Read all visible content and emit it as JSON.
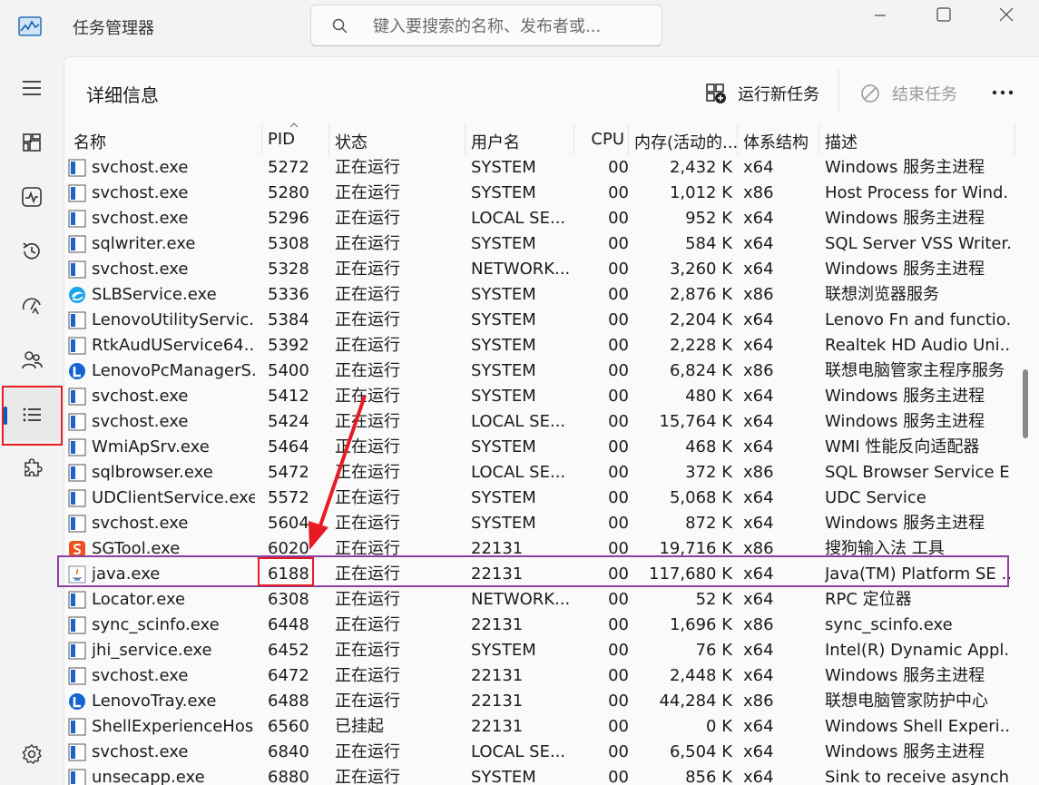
{
  "app": {
    "title": "任务管理器",
    "search_placeholder": "键入要搜索的名称、发布者或..."
  },
  "page": {
    "title": "详细信息",
    "run_new_task": "运行新任务",
    "end_task": "结束任务"
  },
  "columns": [
    "名称",
    "PID",
    "状态",
    "用户名",
    "CPU",
    "内存(活动的...",
    "体系结构",
    "描述"
  ],
  "accent_color": "#005fb8",
  "highlight_row_color": "#8b3fa0",
  "annotation_color": "#e81a24",
  "rows": [
    {
      "icon": "svc-icon",
      "name": "svchost.exe",
      "pid": "5272",
      "status": "正在运行",
      "user": "SYSTEM",
      "cpu": "00",
      "mem": "2,432 K",
      "arch": "x64",
      "desc": "Windows 服务主进程"
    },
    {
      "icon": "svc-icon",
      "name": "svchost.exe",
      "pid": "5280",
      "status": "正在运行",
      "user": "SYSTEM",
      "cpu": "00",
      "mem": "1,012 K",
      "arch": "x86",
      "desc": "Host Process for Wind..."
    },
    {
      "icon": "svc-icon",
      "name": "svchost.exe",
      "pid": "5296",
      "status": "正在运行",
      "user": "LOCAL SE...",
      "cpu": "00",
      "mem": "952 K",
      "arch": "x64",
      "desc": "Windows 服务主进程"
    },
    {
      "icon": "svc-icon",
      "name": "sqlwriter.exe",
      "pid": "5308",
      "status": "正在运行",
      "user": "SYSTEM",
      "cpu": "00",
      "mem": "584 K",
      "arch": "x64",
      "desc": "SQL Server VSS Writer..."
    },
    {
      "icon": "svc-icon",
      "name": "svchost.exe",
      "pid": "5328",
      "status": "正在运行",
      "user": "NETWORK...",
      "cpu": "00",
      "mem": "3,260 K",
      "arch": "x64",
      "desc": "Windows 服务主进程"
    },
    {
      "icon": "browser-icon",
      "name": "SLBService.exe",
      "pid": "5336",
      "status": "正在运行",
      "user": "SYSTEM",
      "cpu": "00",
      "mem": "2,876 K",
      "arch": "x86",
      "desc": "联想浏览器服务"
    },
    {
      "icon": "svc-icon",
      "name": "LenovoUtilityServic...",
      "pid": "5384",
      "status": "正在运行",
      "user": "SYSTEM",
      "cpu": "00",
      "mem": "2,204 K",
      "arch": "x64",
      "desc": "Lenovo Fn and functio..."
    },
    {
      "icon": "svc-icon",
      "name": "RtkAudUService64....",
      "pid": "5392",
      "status": "正在运行",
      "user": "SYSTEM",
      "cpu": "00",
      "mem": "2,228 K",
      "arch": "x64",
      "desc": "Realtek HD Audio Uni..."
    },
    {
      "icon": "lenovo-icon",
      "name": "LenovoPcManagerS...",
      "pid": "5400",
      "status": "正在运行",
      "user": "SYSTEM",
      "cpu": "00",
      "mem": "6,824 K",
      "arch": "x86",
      "desc": "联想电脑管家主程序服务"
    },
    {
      "icon": "svc-icon",
      "name": "svchost.exe",
      "pid": "5412",
      "status": "正在运行",
      "user": "SYSTEM",
      "cpu": "00",
      "mem": "480 K",
      "arch": "x64",
      "desc": "Windows 服务主进程"
    },
    {
      "icon": "svc-icon",
      "name": "svchost.exe",
      "pid": "5424",
      "status": "正在运行",
      "user": "LOCAL SE...",
      "cpu": "00",
      "mem": "15,764 K",
      "arch": "x64",
      "desc": "Windows 服务主进程"
    },
    {
      "icon": "svc-icon",
      "name": "WmiApSrv.exe",
      "pid": "5464",
      "status": "正在运行",
      "user": "SYSTEM",
      "cpu": "00",
      "mem": "468 K",
      "arch": "x64",
      "desc": "WMI 性能反向适配器"
    },
    {
      "icon": "svc-icon",
      "name": "sqlbrowser.exe",
      "pid": "5472",
      "status": "正在运行",
      "user": "LOCAL SE...",
      "cpu": "00",
      "mem": "372 K",
      "arch": "x86",
      "desc": "SQL Browser Service E..."
    },
    {
      "icon": "svc-icon",
      "name": "UDClientService.exe",
      "pid": "5572",
      "status": "正在运行",
      "user": "SYSTEM",
      "cpu": "00",
      "mem": "5,068 K",
      "arch": "x64",
      "desc": "UDC Service"
    },
    {
      "icon": "svc-icon",
      "name": "svchost.exe",
      "pid": "5604",
      "status": "正在运行",
      "user": "SYSTEM",
      "cpu": "00",
      "mem": "872 K",
      "arch": "x64",
      "desc": "Windows 服务主进程"
    },
    {
      "icon": "sogou-icon",
      "name": "SGTool.exe",
      "pid": "6020",
      "status": "正在运行",
      "user": "22131",
      "cpu": "00",
      "mem": "19,716 K",
      "arch": "x86",
      "desc": "搜狗输入法 工具"
    },
    {
      "icon": "java-icon",
      "name": "java.exe",
      "pid": "6188",
      "status": "正在运行",
      "user": "22131",
      "cpu": "00",
      "mem": "117,680 K",
      "arch": "x64",
      "desc": "Java(TM) Platform SE ..."
    },
    {
      "icon": "svc-icon",
      "name": "Locator.exe",
      "pid": "6308",
      "status": "正在运行",
      "user": "NETWORK...",
      "cpu": "00",
      "mem": "52 K",
      "arch": "x64",
      "desc": "RPC 定位器"
    },
    {
      "icon": "svc-icon",
      "name": "sync_scinfo.exe",
      "pid": "6448",
      "status": "正在运行",
      "user": "22131",
      "cpu": "00",
      "mem": "1,696 K",
      "arch": "x86",
      "desc": "sync_scinfo.exe"
    },
    {
      "icon": "svc-icon",
      "name": "jhi_service.exe",
      "pid": "6452",
      "status": "正在运行",
      "user": "SYSTEM",
      "cpu": "00",
      "mem": "76 K",
      "arch": "x64",
      "desc": "Intel(R) Dynamic Appl..."
    },
    {
      "icon": "svc-icon",
      "name": "svchost.exe",
      "pid": "6472",
      "status": "正在运行",
      "user": "22131",
      "cpu": "00",
      "mem": "2,448 K",
      "arch": "x64",
      "desc": "Windows 服务主进程"
    },
    {
      "icon": "lenovo-icon",
      "name": "LenovoTray.exe",
      "pid": "6488",
      "status": "正在运行",
      "user": "22131",
      "cpu": "00",
      "mem": "44,284 K",
      "arch": "x86",
      "desc": "联想电脑管家防护中心"
    },
    {
      "icon": "svc-icon",
      "name": "ShellExperienceHos...",
      "pid": "6560",
      "status": "已挂起",
      "user": "22131",
      "cpu": "00",
      "mem": "0 K",
      "arch": "x64",
      "desc": "Windows Shell Experi..."
    },
    {
      "icon": "svc-icon",
      "name": "svchost.exe",
      "pid": "6840",
      "status": "正在运行",
      "user": "LOCAL SE...",
      "cpu": "00",
      "mem": "6,504 K",
      "arch": "x64",
      "desc": "Windows 服务主进程"
    },
    {
      "icon": "svc-icon",
      "name": "unsecapp.exe",
      "pid": "6880",
      "status": "正在运行",
      "user": "SYSTEM",
      "cpu": "00",
      "mem": "856 K",
      "arch": "x64",
      "desc": "Sink to receive asynch..."
    }
  ]
}
